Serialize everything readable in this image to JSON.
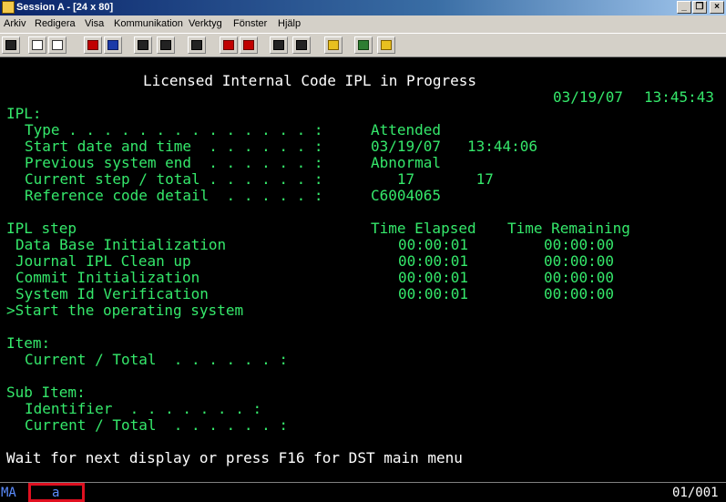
{
  "window": {
    "title": "Session A - [24 x 80]",
    "controls": {
      "minimize": "_",
      "restore": "❐",
      "close": "×"
    }
  },
  "menu": [
    "Arkiv",
    "Redigera",
    "Visa",
    "Kommunikation",
    "Verktyg",
    "Fönster",
    "Hjälp"
  ],
  "toolbar": {
    "icons": [
      "print-screen-icon",
      "copy-icon",
      "paste-icon",
      "send-icon",
      "receive-icon",
      "display-icon",
      "keyboard-icon",
      "macro-record-icon",
      "macro-stop-icon",
      "macro-play-icon",
      "macro-pause-icon",
      "clipboard-icon",
      "globe-icon",
      "help-icon"
    ]
  },
  "screen": {
    "header": "Licensed Internal Code IPL in Progress",
    "date": "03/19/07",
    "time": "13:45:43",
    "ipl_label": "IPL:",
    "fields": [
      {
        "label": "Type . . . . . . . . . . . . . . :",
        "value": "Attended"
      },
      {
        "label": "Start date and time  . . . . . . :",
        "value": "03/19/07   13:44:06"
      },
      {
        "label": "Previous system end  . . . . . . :",
        "value": "Abnormal"
      },
      {
        "label": "Current step / total . . . . . . :",
        "value": "   17       17"
      },
      {
        "label": "Reference code detail  . . . . . :",
        "value": "C6004065"
      }
    ],
    "steps_header": {
      "step": "IPL step",
      "elapsed": "Time Elapsed",
      "remaining": "Time Remaining"
    },
    "steps": [
      {
        "name": "Data Base Initialization",
        "elapsed": "00:00:01",
        "remaining": "00:00:00"
      },
      {
        "name": "Journal IPL Clean up",
        "elapsed": "00:00:01",
        "remaining": "00:00:00"
      },
      {
        "name": "Commit Initialization",
        "elapsed": "00:00:01",
        "remaining": "00:00:00"
      },
      {
        "name": "System Id Verification",
        "elapsed": "00:00:01",
        "remaining": "00:00:00"
      }
    ],
    "current_step": ">Start the operating system",
    "item_label": "Item:",
    "item_current_total": "Current / Total  . . . . . . :",
    "subitem_label": "Sub Item:",
    "subitem_identifier": "Identifier  . . . . . . . :",
    "subitem_current_total": "Current / Total  . . . . . . :",
    "message": "Wait for next display or press F16 for DST main menu"
  },
  "status": {
    "mode": "MA",
    "indicator": "a",
    "position": "01/001"
  }
}
